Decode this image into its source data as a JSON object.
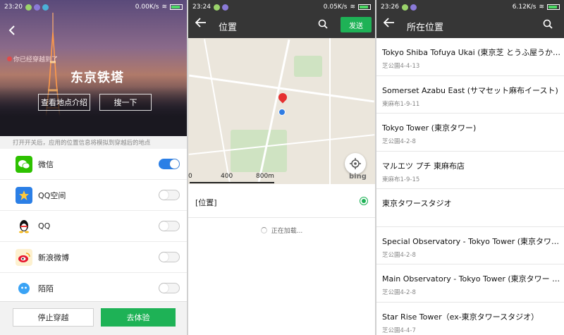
{
  "left_panel": {
    "status": {
      "time": "23:20",
      "speed": "0.00K/s"
    },
    "location_note": "你已经穿越到了",
    "place_title": "东京铁塔",
    "intro_button": "查看地点介绍",
    "search_button": "搜一下",
    "hint": "打开开关后，应用的位置信息将模拟到穿越后的地点",
    "apps": [
      {
        "name": "微信",
        "icon": "wechat-icon",
        "color": "#2dc100",
        "enabled": true
      },
      {
        "name": "QQ空间",
        "icon": "qzone-icon",
        "color": "#2b7fe6",
        "enabled": false
      },
      {
        "name": "QQ",
        "icon": "qq-penguin-icon",
        "color": "#ffffff",
        "enabled": false
      },
      {
        "name": "新浪微博",
        "icon": "weibo-icon",
        "color": "#f5b819",
        "enabled": false
      },
      {
        "name": "陌陌",
        "icon": "momo-icon",
        "color": "#3aa3f5",
        "enabled": false
      }
    ],
    "stop_button": "停止穿越",
    "try_button": "去体验"
  },
  "middle_panel": {
    "status": {
      "time": "23:24",
      "speed": "0.05K/s"
    },
    "title": "位置",
    "send_button": "发送",
    "scale_labels": [
      "0",
      "400",
      "800m"
    ],
    "bing_label": "bing",
    "position_label": "[位置]",
    "loading_text": "正在加载..."
  },
  "right_panel": {
    "status": {
      "time": "23:26",
      "speed": "6.12K/s"
    },
    "title": "所在位置",
    "places": [
      {
        "name": "Tokyo Shiba Tofuya Ukai (東京芝 とうふ屋うか…",
        "addr": "芝公園4-4-13"
      },
      {
        "name": "Somerset Azabu East (サマセット麻布イースト)",
        "addr": "東麻布1-9-11"
      },
      {
        "name": "Tokyo Tower (東京タワー)",
        "addr": "芝公園4-2-8"
      },
      {
        "name": "マルエツ プチ 東麻布店",
        "addr": "東麻布1-9-15"
      },
      {
        "name": "東京タワースタジオ",
        "addr": ""
      },
      {
        "name": "Special Observatory - Tokyo Tower (東京タワー…",
        "addr": "芝公園4-2-8"
      },
      {
        "name": "Main Observatory - Tokyo Tower (東京タワー 大…",
        "addr": "芝公園4-2-8"
      },
      {
        "name": "Star Rise Tower（ex-東京タワースタジオ）",
        "addr": "芝公園4-4-7"
      }
    ]
  },
  "colors": {
    "accent_green": "#1eb256",
    "header_dark": "#363636",
    "toggle_blue": "#2b7fe6"
  }
}
